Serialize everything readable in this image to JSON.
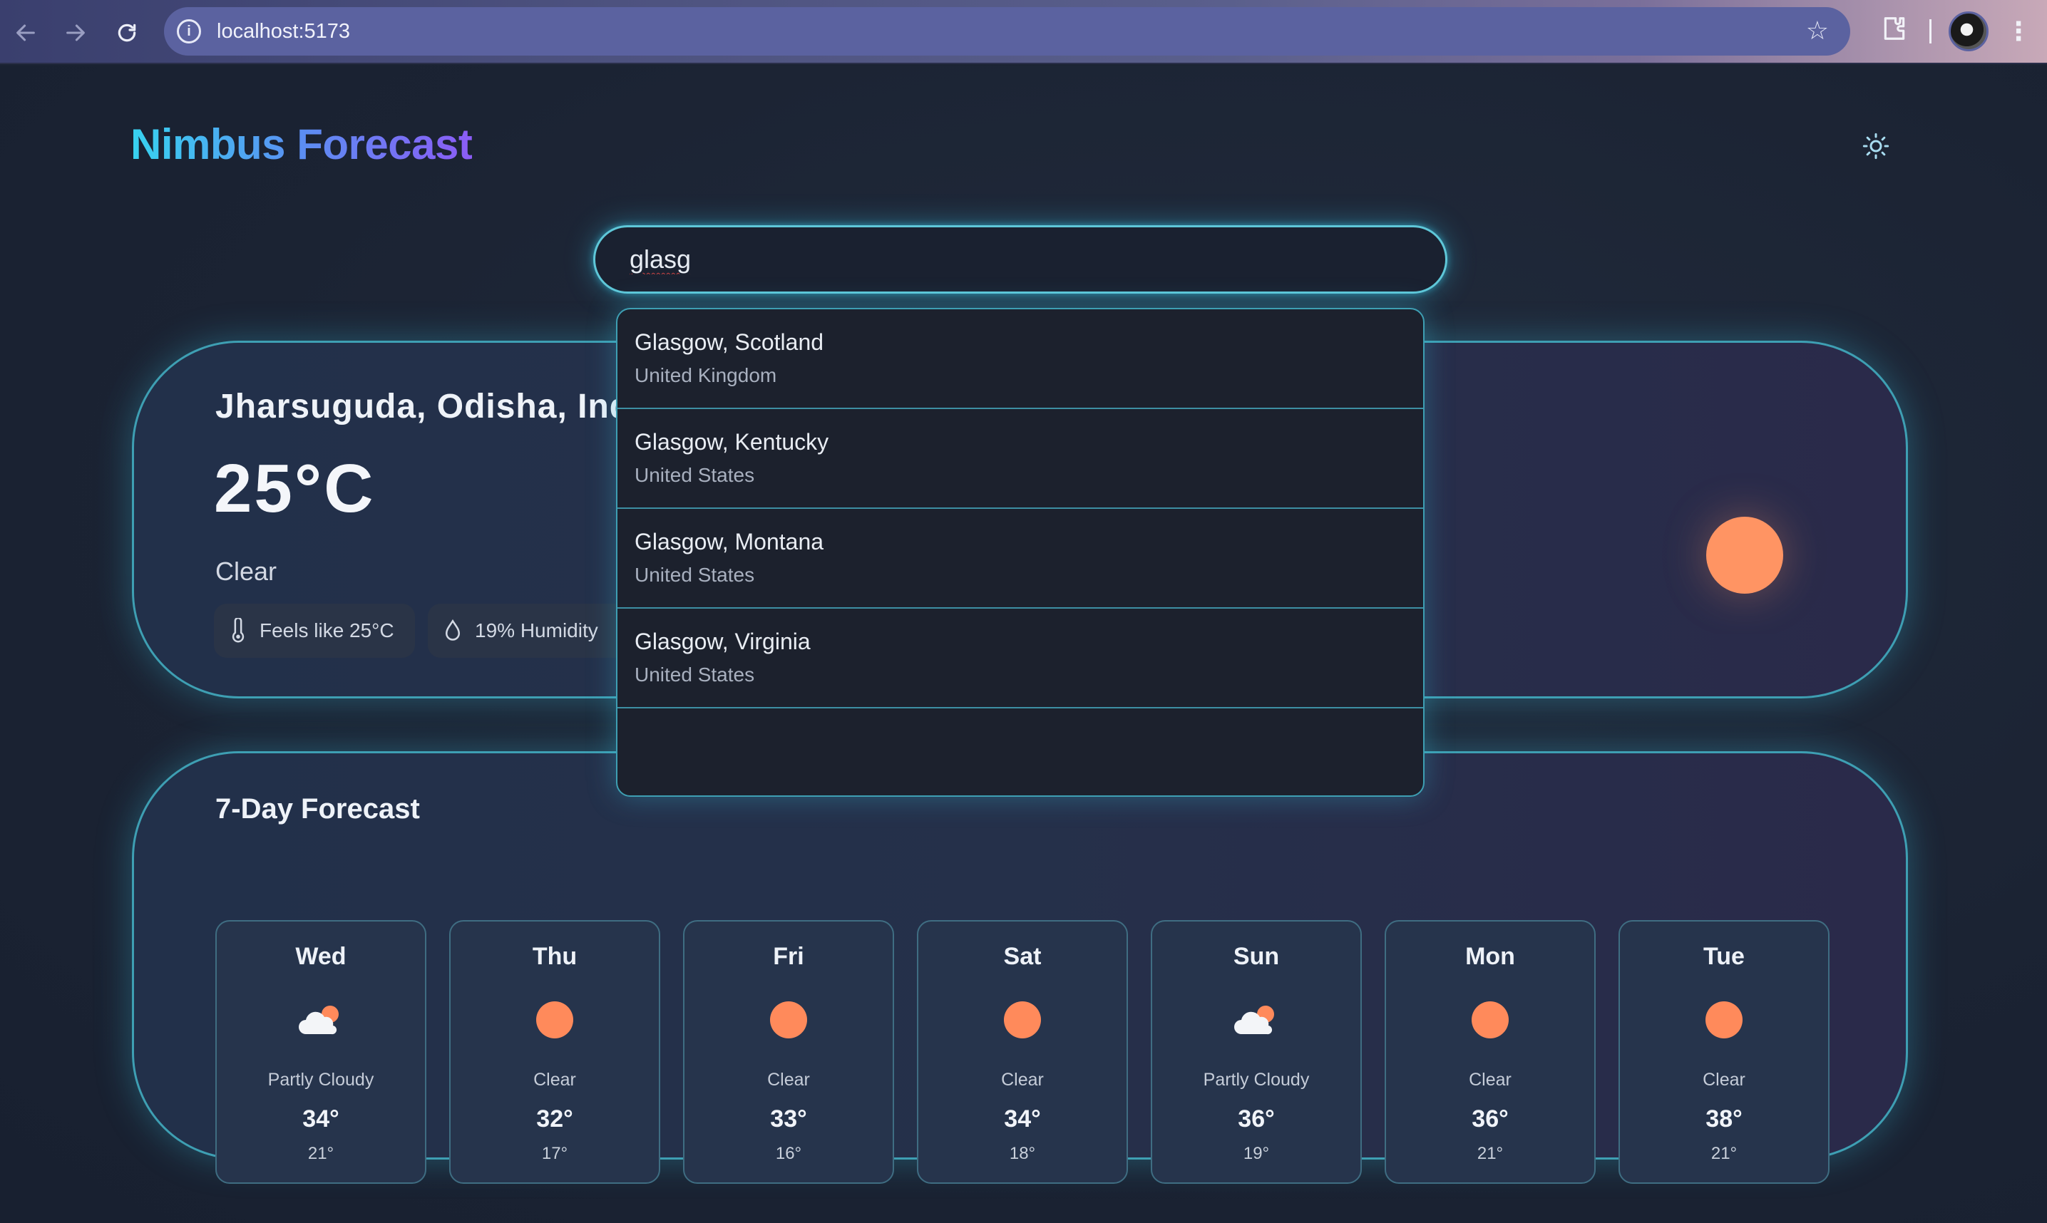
{
  "browser": {
    "url": "localhost:5173"
  },
  "app": {
    "brand": "Nimbus Forecast",
    "search": {
      "value": "glasg"
    },
    "current": {
      "location": "Jharsuguda, Odisha, India",
      "temperature": "25°C",
      "condition": "Clear",
      "feels_like": "Feels like 25°C",
      "humidity": "19% Humidity"
    },
    "suggestions": [
      {
        "city": "Glasgow, Scotland",
        "country": "United Kingdom"
      },
      {
        "city": "Glasgow, Kentucky",
        "country": "United States"
      },
      {
        "city": "Glasgow, Montana",
        "country": "United States"
      },
      {
        "city": "Glasgow, Virginia",
        "country": "United States"
      }
    ],
    "forecast": {
      "heading": "7-Day Forecast",
      "days": [
        {
          "day": "Wed",
          "icon": "partly-cloudy-icon",
          "condition": "Partly Cloudy",
          "high": "34°",
          "low": "21°"
        },
        {
          "day": "Thu",
          "icon": "sun-icon",
          "condition": "Clear",
          "high": "32°",
          "low": "17°"
        },
        {
          "day": "Fri",
          "icon": "sun-icon",
          "condition": "Clear",
          "high": "33°",
          "low": "16°"
        },
        {
          "day": "Sat",
          "icon": "sun-icon",
          "condition": "Clear",
          "high": "34°",
          "low": "18°"
        },
        {
          "day": "Sun",
          "icon": "partly-cloudy-icon",
          "condition": "Partly Cloudy",
          "high": "36°",
          "low": "19°"
        },
        {
          "day": "Mon",
          "icon": "sun-icon",
          "condition": "Clear",
          "high": "36°",
          "low": "21°"
        },
        {
          "day": "Tue",
          "icon": "sun-icon",
          "condition": "Clear",
          "high": "38°",
          "low": "21°"
        }
      ]
    }
  },
  "colors": {
    "accent_cyan": "#5fc7d8",
    "sun_orange": "#ff9463",
    "background": "#1b2333"
  }
}
